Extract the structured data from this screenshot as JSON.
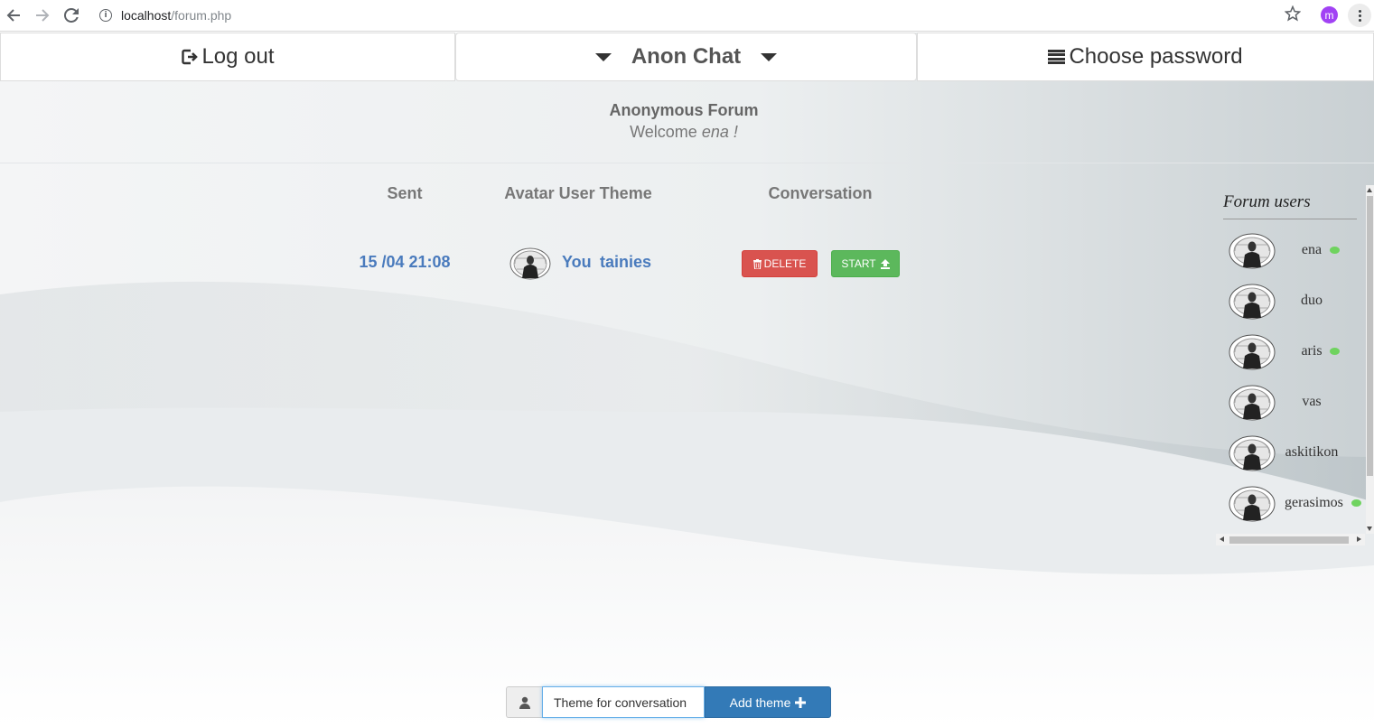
{
  "browser": {
    "url_host": "localhost",
    "url_path": "/forum.php",
    "profile_initial": "m"
  },
  "nav": {
    "logout_label": "Log out",
    "brand_label": "Anon Chat",
    "password_label": "Choose password"
  },
  "header": {
    "title": "Anonymous Forum",
    "welcome_prefix": "Welcome",
    "welcome_user": "ena !"
  },
  "table": {
    "columns": [
      "Sent",
      "Avatar User Theme",
      "Conversation"
    ],
    "rows": [
      {
        "sent": "15 /04 21:08",
        "user": "You",
        "theme": "tainies",
        "delete_label": "DELETE",
        "start_label": "START"
      }
    ]
  },
  "users_panel": {
    "title": "Forum users",
    "users": [
      {
        "name": "ena",
        "online": true
      },
      {
        "name": "duo",
        "online": false
      },
      {
        "name": "aris",
        "online": true
      },
      {
        "name": "vas",
        "online": false
      },
      {
        "name": "askitikon",
        "online": false
      },
      {
        "name": "gerasimos",
        "online": true
      }
    ]
  },
  "composer": {
    "placeholder": "Theme for conversation",
    "add_label": "Add theme"
  },
  "colors": {
    "link_blue": "#4a7bbd",
    "danger": "#d9534f",
    "success": "#5cb85c",
    "primary": "#337ab7",
    "online_dot": "#6fd35f"
  }
}
